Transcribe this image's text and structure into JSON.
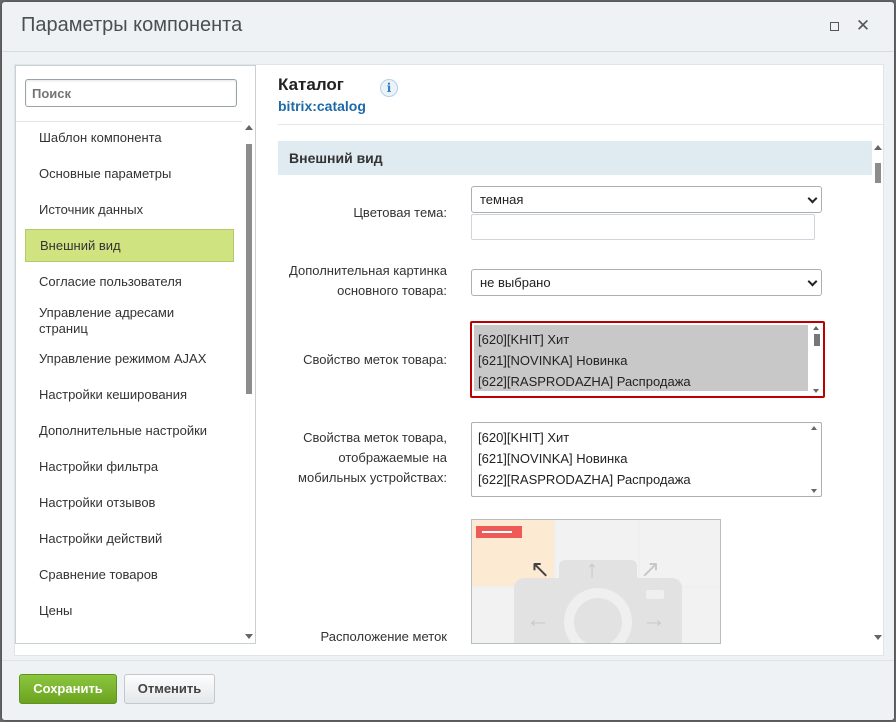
{
  "dialog": {
    "title": "Параметры компонента",
    "minimize_icon": "square-icon",
    "close_label": "✕"
  },
  "sidebar": {
    "search_placeholder": "Поиск",
    "items": [
      {
        "label": "Шаблон компонента"
      },
      {
        "label": "Основные параметры"
      },
      {
        "label": "Источник данных"
      },
      {
        "label": "Внешний вид",
        "active": true
      },
      {
        "label": "Согласие пользователя"
      },
      {
        "label": "Управление адресами страниц"
      },
      {
        "label": "Управление режимом AJAX"
      },
      {
        "label": "Настройки кеширования"
      },
      {
        "label": "Дополнительные настройки"
      },
      {
        "label": "Настройки фильтра"
      },
      {
        "label": "Настройки отзывов"
      },
      {
        "label": "Настройки действий"
      },
      {
        "label": "Сравнение товаров"
      },
      {
        "label": "Цены"
      }
    ]
  },
  "component": {
    "title": "Каталог",
    "code": "bitrix:catalog",
    "info_label": "i"
  },
  "section": {
    "title": "Внешний вид"
  },
  "fields": {
    "color_theme": {
      "label": "Цветовая тема:",
      "value": "темная",
      "extra_value": ""
    },
    "extra_picture": {
      "label_line1": "Дополнительная картинка",
      "label_line2": "основного товара:",
      "value": "не выбрано"
    },
    "label_props": {
      "label": "Свойство меток товара:",
      "options": [
        "[620][KHIT] Хит",
        "[621][NOVINKA] Новинка",
        "[622][RASPRODAZHA] Распродажа"
      ]
    },
    "mobile_label_props": {
      "label_line1": "Свойства меток товара,",
      "label_line2": "отображаемые на",
      "label_line3": "мобильных устройствах:",
      "options": [
        "[620][KHIT] Хит",
        "[621][NOVINKA] Новинка",
        "[622][RASPRODAZHA] Распродажа"
      ]
    },
    "label_position": {
      "label": "Расположение меток"
    }
  },
  "footer": {
    "save_label": "Сохранить",
    "cancel_label": "Отменить"
  },
  "colors": {
    "save_button": "#7ab52e",
    "active_item": "#cfe480",
    "section_header": "#e0eaf1",
    "highlight_border": "#bb0000",
    "link": "#1e6aa8"
  }
}
